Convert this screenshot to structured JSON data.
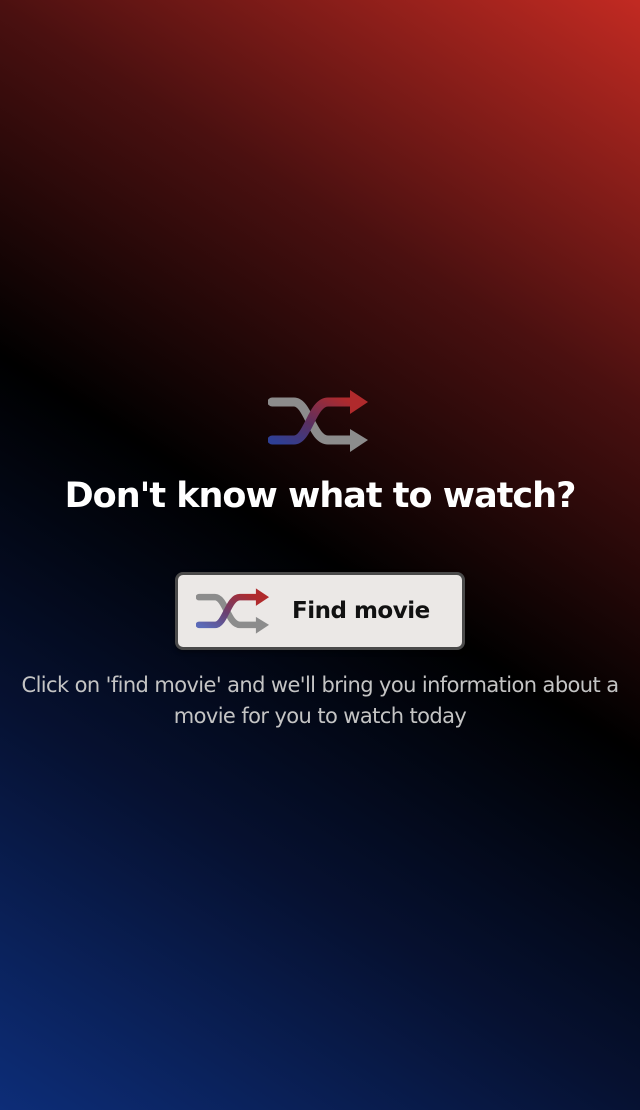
{
  "hero": {
    "icon": "shuffle-icon",
    "headline": "Don't know what to watch?"
  },
  "find_button": {
    "icon": "shuffle-icon",
    "label": "Find movie"
  },
  "description": "Click on 'find movie' and we'll bring you information about a movie for you to watch today",
  "colors": {
    "gradient_top_right": "#c22a22",
    "gradient_center": "#000000",
    "gradient_bottom_left": "#0d2d78",
    "icon_red": "#a12a30",
    "icon_blue": "#3a4aa0",
    "icon_gray": "#8c8c8c",
    "button_bg": "#ebe8e6",
    "button_border": "#4a4a4a",
    "headline_text": "#ffffff",
    "description_text": "#c4c4c4"
  }
}
